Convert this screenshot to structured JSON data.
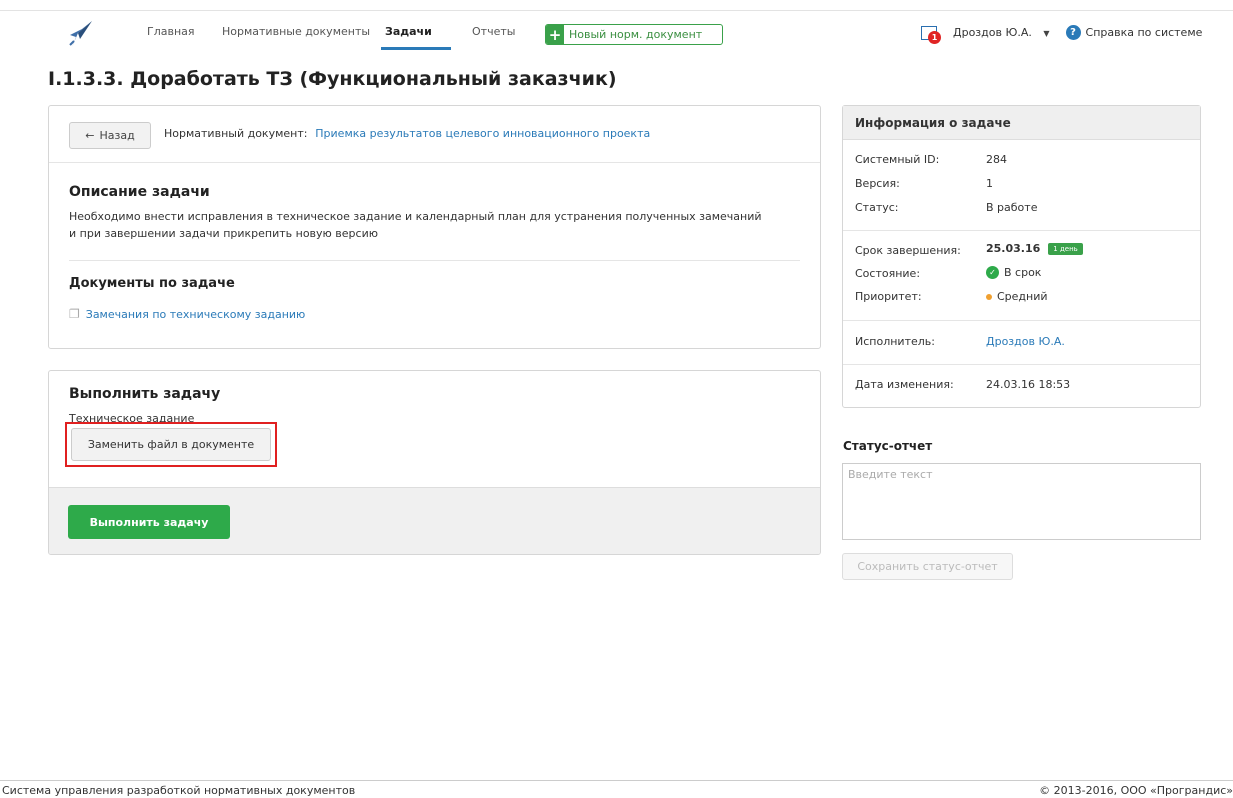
{
  "nav": {
    "items": [
      "Главная",
      "Нормативные документы",
      "Задачи",
      "Отчеты"
    ],
    "active": "Задачи",
    "new_doc": "Новый норм. документ"
  },
  "header": {
    "task_badge_count": "1",
    "user_name": "Дроздов Ю.А.",
    "help_label": "Справка по системе"
  },
  "page": {
    "title": "I.1.3.3. Доработать ТЗ (Функциональный заказчик)"
  },
  "task_panel": {
    "back_label": "Назад",
    "norm_doc_label": "Нормативный документ:",
    "norm_doc_link": "Приемка результатов целевого инновационного проекта",
    "description_heading": "Описание задачи",
    "description_line1": "Необходимо внести исправления в техническое задание и календарный план для устранения полученных замечаний",
    "description_line2": "и при завершении задачи прикрепить новую версию",
    "docs_heading": "Документы по задаче",
    "doc_link": "Замечания по техническому заданию"
  },
  "execute_panel": {
    "heading": "Выполнить задачу",
    "field_label": "Техническое задание",
    "replace_button": "Заменить файл в документе",
    "complete_button": "Выполнить задачу"
  },
  "info": {
    "heading": "Информация о задаче",
    "system_id_label": "Системный ID:",
    "system_id": "284",
    "version_label": "Версия:",
    "version": "1",
    "status_label": "Статус:",
    "status": "В работе",
    "deadline_label": "Срок завершения:",
    "deadline": "25.03.16",
    "deadline_badge": "1 день",
    "state_label": "Состояние:",
    "state": "В срок",
    "priority_label": "Приоритет:",
    "priority": "Средний",
    "assignee_label": "Исполнитель:",
    "assignee": "Дроздов Ю.А.",
    "modified_label": "Дата изменения:",
    "modified": "24.03.16 18:53"
  },
  "status_report": {
    "heading": "Статус-отчет",
    "placeholder": "Введите текст",
    "save_button": "Сохранить статус-отчет"
  },
  "footer": {
    "left": "Система управления разработкой нормативных документов",
    "right": "© 2013-2016, ООО «Програндис»"
  },
  "colors": {
    "accent": "#2a7ab8",
    "success": "#2eaa4a",
    "highlight": "#e02020"
  }
}
